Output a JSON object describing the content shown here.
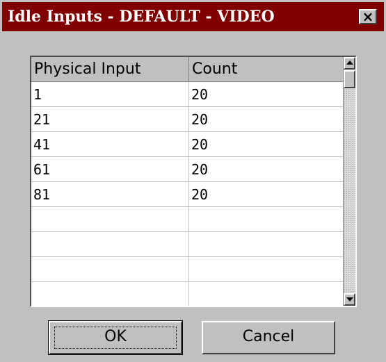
{
  "window": {
    "title": "Idle Inputs - DEFAULT - VIDEO",
    "close_label": "×"
  },
  "table": {
    "columns": [
      "Physical Input",
      "Count"
    ],
    "rows": [
      [
        "1",
        "20"
      ],
      [
        "21",
        "20"
      ],
      [
        "41",
        "20"
      ],
      [
        "61",
        "20"
      ],
      [
        "81",
        "20"
      ],
      [
        "",
        ""
      ],
      [
        "",
        ""
      ],
      [
        "",
        ""
      ],
      [
        "",
        ""
      ]
    ]
  },
  "buttons": {
    "ok_label": "OK",
    "cancel_label": "Cancel"
  },
  "colors": {
    "titlebar": "#800000",
    "face": "#c0c0c0"
  }
}
